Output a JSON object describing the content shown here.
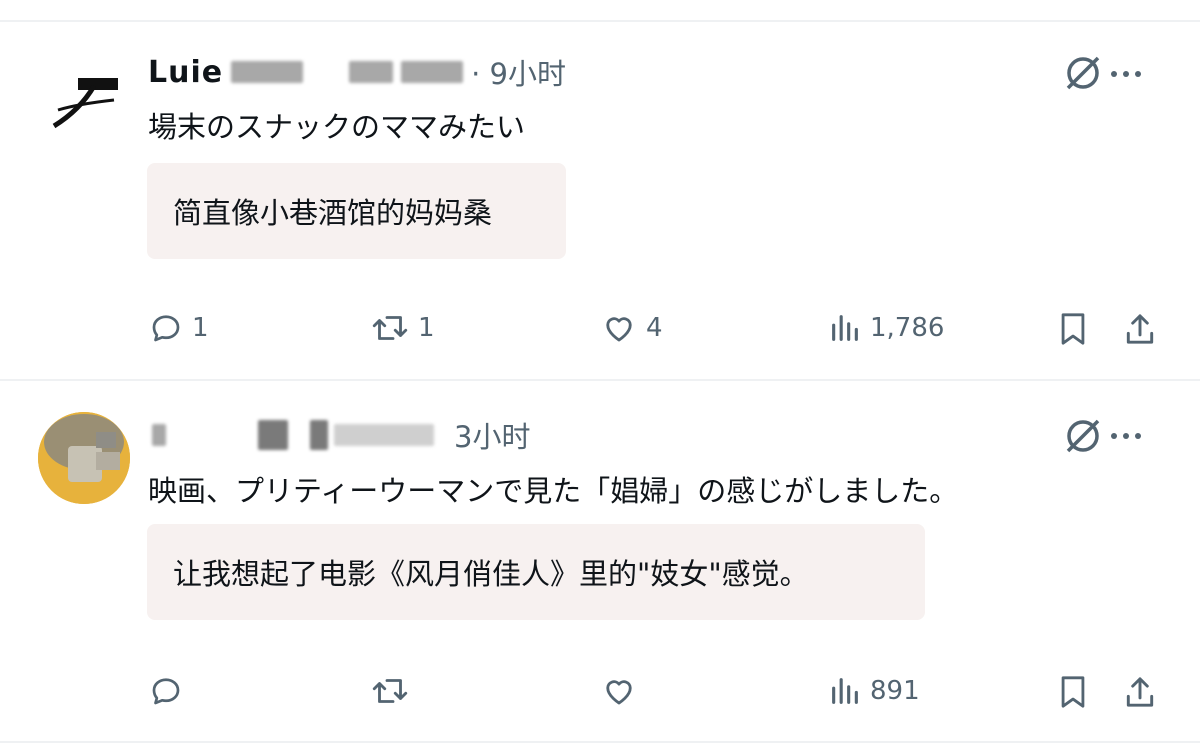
{
  "posts": [
    {
      "name_visible": "Luie",
      "time": "· 9小时",
      "text": "場末のスナックのママみたい",
      "translation": "简直像小巷酒馆的妈妈桑",
      "actions": {
        "reply_count": "1",
        "repost_count": "1",
        "like_count": "4",
        "views_count": "1,786"
      }
    },
    {
      "name_visible": "",
      "time": "3小时",
      "text": "映画、プリティーウーマンで見た「娼婦」の感じがしました。",
      "translation": "让我想起了电影《风月俏佳人》里的\"妓女\"感觉。",
      "actions": {
        "reply_count": "",
        "repost_count": "",
        "like_count": "",
        "views_count": "891"
      }
    }
  ],
  "colors": {
    "text": "#0f1419",
    "secondary": "#536471",
    "translation_bg": "#f7f1f0",
    "divider": "#eff1f3"
  }
}
